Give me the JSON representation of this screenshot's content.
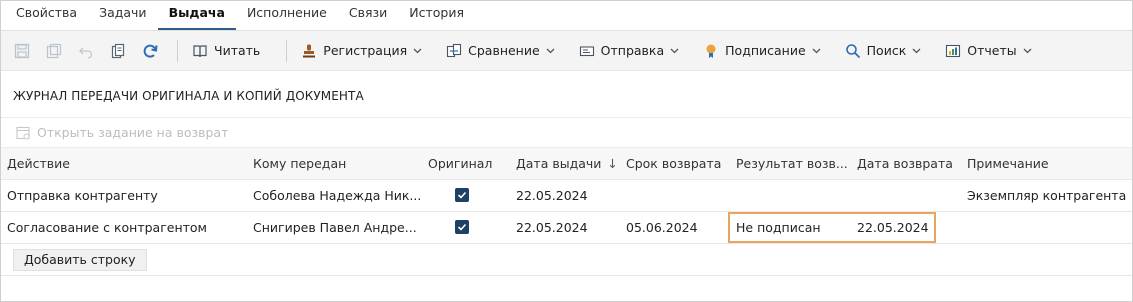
{
  "tabs": [
    "Свойства",
    "Задачи",
    "Выдача",
    "Исполнение",
    "Связи",
    "История"
  ],
  "active_tab_index": 2,
  "toolbar": {
    "read": "Читать",
    "registration": "Регистрация",
    "compare": "Сравнение",
    "send": "Отправка",
    "signing": "Подписание",
    "search": "Поиск",
    "reports": "Отчеты"
  },
  "journal": {
    "title": "ЖУРНАЛ ПЕРЕДАЧИ ОРИГИНАЛА И КОПИЙ ДОКУМЕНТА",
    "open_return_task": "Открыть задание на возврат"
  },
  "table": {
    "columns": [
      "Действие",
      "Кому передан",
      "Оригинал",
      "Дата выдачи",
      "Срок возврата",
      "Результат возв...",
      "Дата возврата",
      "Примечание"
    ],
    "rows": [
      {
        "action": "Отправка контрагенту",
        "recipient": "Соболева Надежда Ник...",
        "original": true,
        "issue_date": "22.05.2024",
        "due_date": "",
        "return_result": "",
        "return_date": "",
        "note": "Экземпляр контрагента"
      },
      {
        "action": "Согласование с контрагентом",
        "recipient": "Снигирев Павел Андре...",
        "original": true,
        "issue_date": "22.05.2024",
        "due_date": "05.06.2024",
        "return_result": "Не подписан",
        "return_date": "22.05.2024",
        "note": ""
      }
    ],
    "add_row": "Добавить строку"
  },
  "colors": {
    "accent": "#2e5b8a",
    "checkbox": "#1e3f66",
    "highlight": "#e8a55c"
  }
}
